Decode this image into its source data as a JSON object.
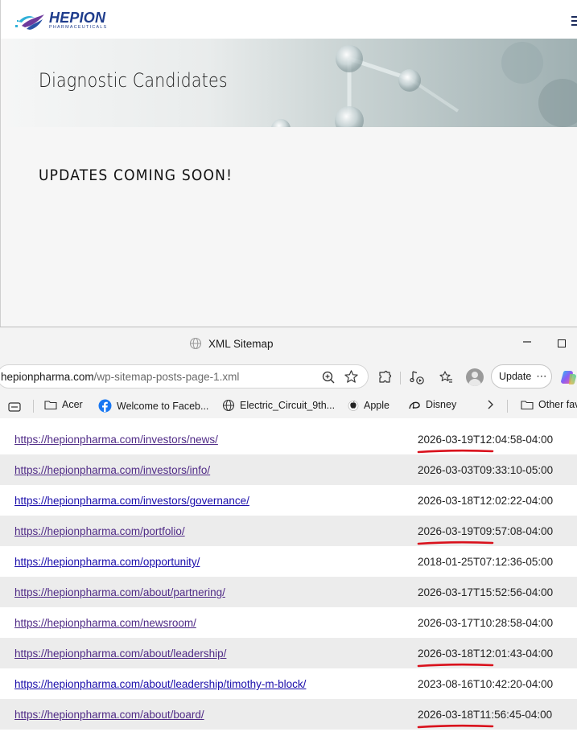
{
  "site": {
    "logo_name": "HEPION",
    "logo_sub": "PHARMACEUTICALS",
    "hero_title": "Diagnostic Candidates",
    "notice": "UPDATES COMING SOON!"
  },
  "browser": {
    "window_title": "XML Sitemap",
    "url_host": "hepionpharma.com",
    "url_path": "/wp-sitemap-posts-page-1.xml",
    "update_label": "Update",
    "bookmarks": [
      {
        "label": "Acer",
        "icon": "folder-icon"
      },
      {
        "label": "Welcome to Faceb...",
        "icon": "facebook-icon"
      },
      {
        "label": "Electric_Circuit_9th...",
        "icon": "globe-icon"
      },
      {
        "label": "Apple",
        "icon": "apple-icon"
      },
      {
        "label": "Disney",
        "icon": "disney-icon"
      },
      {
        "label": "Other fav",
        "icon": "folder-icon"
      }
    ]
  },
  "sitemap": {
    "rows": [
      {
        "url": "https://hepionpharma.com/investors/news/",
        "lastmod": "2026-03-19T12:04:58-04:00",
        "visited": true,
        "highlighted": true
      },
      {
        "url": "https://hepionpharma.com/investors/info/",
        "lastmod": "2026-03-03T09:33:10-05:00",
        "visited": true,
        "highlighted": false
      },
      {
        "url": "https://hepionpharma.com/investors/governance/",
        "lastmod": "2026-03-18T12:02:22-04:00",
        "visited": false,
        "highlighted": false
      },
      {
        "url": "https://hepionpharma.com/portfolio/",
        "lastmod": "2026-03-19T09:57:08-04:00",
        "visited": true,
        "highlighted": true
      },
      {
        "url": "https://hepionpharma.com/opportunity/",
        "lastmod": "2018-01-25T07:12:36-05:00",
        "visited": false,
        "highlighted": false
      },
      {
        "url": "https://hepionpharma.com/about/partnering/",
        "lastmod": "2026-03-17T15:52:56-04:00",
        "visited": true,
        "highlighted": false
      },
      {
        "url": "https://hepionpharma.com/newsroom/",
        "lastmod": "2026-03-17T10:28:58-04:00",
        "visited": true,
        "highlighted": false
      },
      {
        "url": "https://hepionpharma.com/about/leadership/",
        "lastmod": "2026-03-18T12:01:43-04:00",
        "visited": true,
        "highlighted": true
      },
      {
        "url": "https://hepionpharma.com/about/leadership/timothy-m-block/",
        "lastmod": "2023-08-16T10:42:20-04:00",
        "visited": false,
        "highlighted": false
      },
      {
        "url": "https://hepionpharma.com/about/board/",
        "lastmod": "2026-03-18T11:56:45-04:00",
        "visited": true,
        "highlighted": true
      }
    ]
  },
  "colors": {
    "link": "#1a0dab",
    "link_visited": "#4f2a86",
    "annotation": "#d9111c",
    "brand": "#1e3c8c"
  }
}
